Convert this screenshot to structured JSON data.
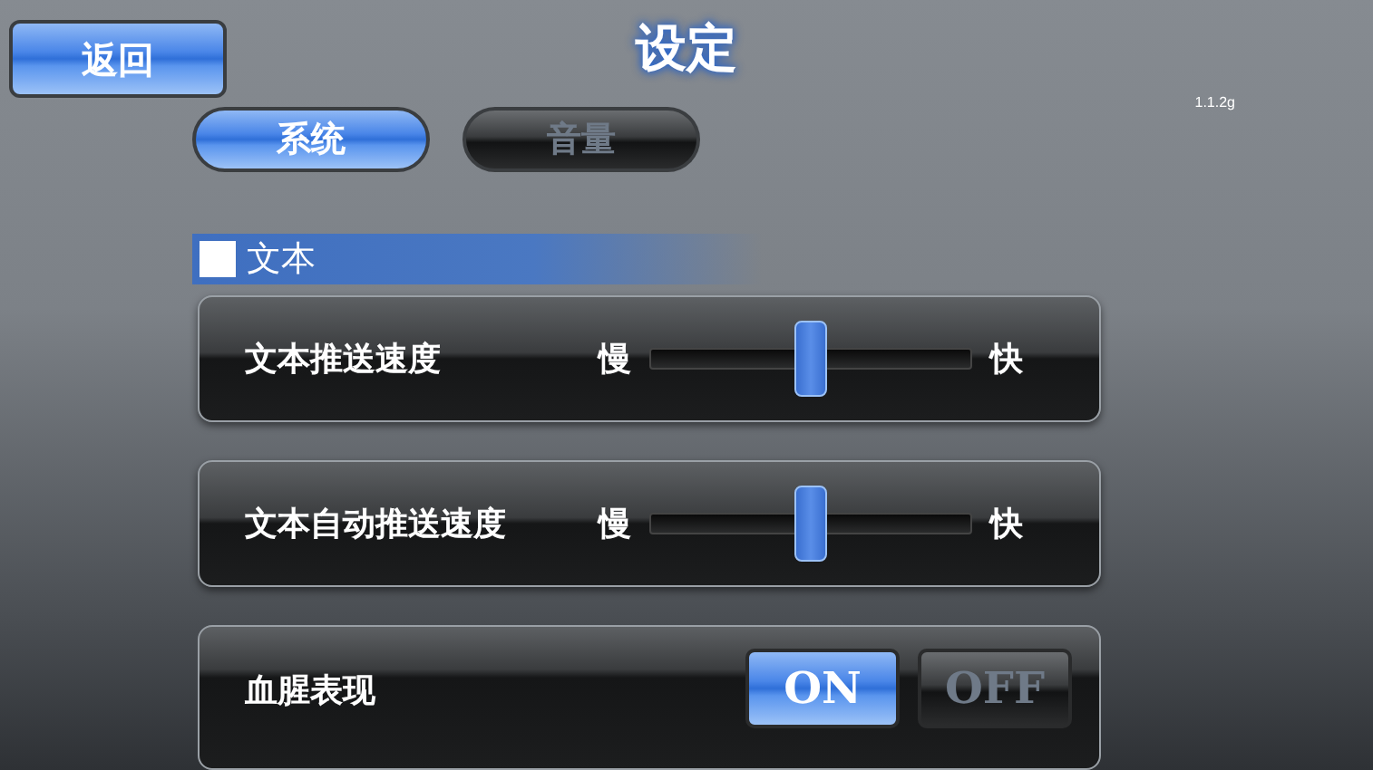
{
  "back_button": {
    "label": "返回"
  },
  "title": "设定",
  "version": "1.1.2g",
  "tabs": [
    {
      "label": "系统",
      "selected": true
    },
    {
      "label": "音量",
      "selected": false
    }
  ],
  "section": {
    "label": "文本"
  },
  "rows": [
    {
      "kind": "slider",
      "label": "文本推送速度",
      "min_label": "慢",
      "max_label": "快",
      "level": 0.5
    },
    {
      "kind": "slider",
      "label": "文本自动推送速度",
      "min_label": "慢",
      "max_label": "快",
      "level": 0.5
    },
    {
      "kind": "toggle",
      "label": "血腥表现",
      "options": [
        {
          "label": "ON",
          "selected": true
        },
        {
          "label": "OFF",
          "selected": false
        }
      ]
    }
  ]
}
